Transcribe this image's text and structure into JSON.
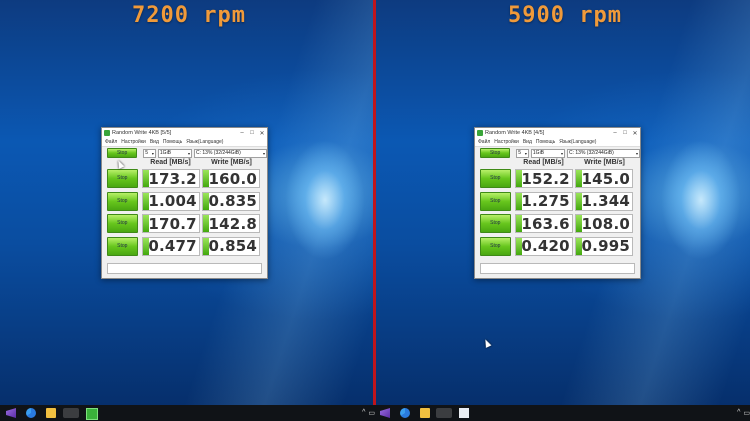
{
  "left": {
    "label": "7200 rpm",
    "window": {
      "title": "Random Write 4KB [5/5]",
      "menu": [
        "Файл",
        "Настройки",
        "Вид",
        "Помощь",
        "Язык(Language)"
      ],
      "runs_value": "5",
      "size_value": "1GiB",
      "drive_value": "C: 13% (32/244GiB)",
      "headers": {
        "read": "Read [MB/s]",
        "write": "Write [MB/s]"
      },
      "button_label": "Stop",
      "rows": [
        {
          "read": "173.2",
          "write": "160.0"
        },
        {
          "read": "1.004",
          "write": "0.835"
        },
        {
          "read": "170.7",
          "write": "142.8"
        },
        {
          "read": "0.477",
          "write": "0.854"
        }
      ]
    }
  },
  "right": {
    "label": "5900 rpm",
    "window": {
      "title": "Random Write 4KB [4/5]",
      "menu": [
        "Файл",
        "Настройки",
        "Вид",
        "Помощь",
        "Язык(Language)"
      ],
      "runs_value": "5",
      "size_value": "1GiB",
      "drive_value": "C: 13% (32/244GiB)",
      "headers": {
        "read": "Read [MB/s]",
        "write": "Write [MB/s]"
      },
      "button_label": "Stop",
      "rows": [
        {
          "read": "152.2",
          "write": "145.0"
        },
        {
          "read": "1.275",
          "write": "1.344"
        },
        {
          "read": "163.6",
          "write": "108.0"
        },
        {
          "read": "0.420",
          "write": "0.995"
        }
      ]
    }
  },
  "taskbar": {
    "icons": [
      "visual-studio-icon",
      "chrome-icon",
      "file-explorer-icon",
      "app-icon",
      "crystaldiskmark-icon"
    ],
    "tray_chevron": "^"
  }
}
